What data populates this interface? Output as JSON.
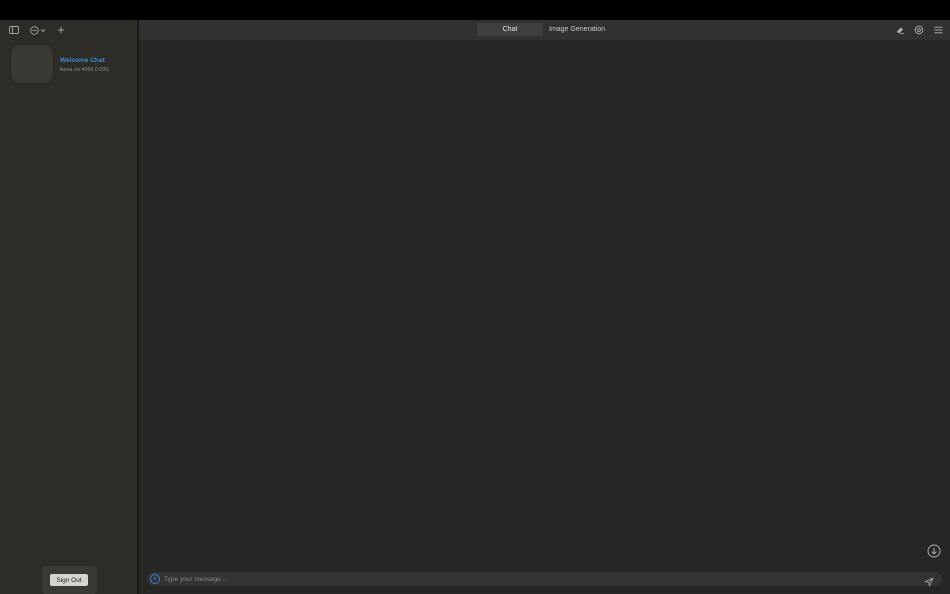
{
  "sidebar": {
    "toolbar_icons": [
      "sidebar-toggle-icon",
      "model-selector-icon",
      "chevron-down-icon",
      "plus-icon"
    ],
    "chats": [
      {
        "title": "Welcome Chat",
        "meta": "llama ctx:4096 0.09G"
      }
    ],
    "sign_out_label": "Sign Out"
  },
  "header": {
    "tabs": [
      {
        "label": "Chat",
        "active": true
      },
      {
        "label": "Image Generation",
        "active": false
      }
    ],
    "right_icons": [
      "eraser-icon",
      "settings-icon",
      "menu-icon"
    ]
  },
  "composer": {
    "placeholder": "Type your message...",
    "value": ""
  },
  "colors": {
    "accent": "#3f8bd9",
    "sidebar_bg": "#2e2c27",
    "main_bg": "#262626"
  }
}
